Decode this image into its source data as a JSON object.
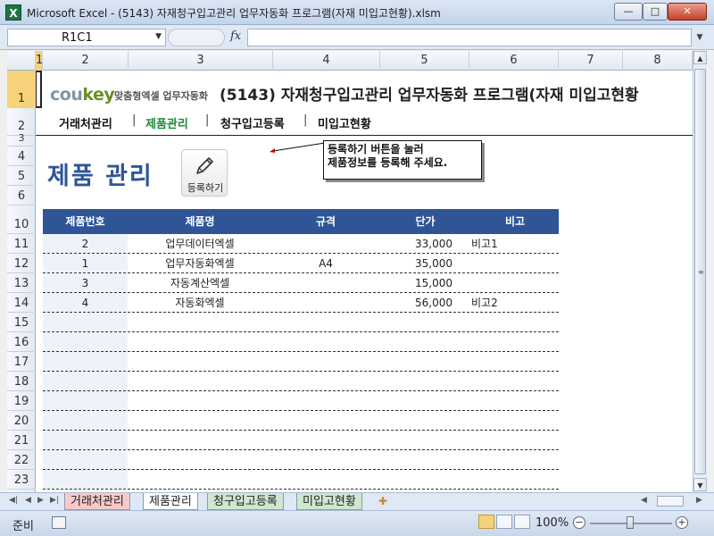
{
  "window": {
    "title": "Microsoft Excel - (5143) 자재청구입고관리 업무자동화 프로그램(자재 미입고현황).xlsm",
    "app_icon": "X",
    "minimize": "—",
    "maximize": "□",
    "close": "✕"
  },
  "formula_bar": {
    "name_box": "R1C1",
    "fx": "fx",
    "formula": ""
  },
  "columns": [
    "1",
    "2",
    "3",
    "4",
    "5",
    "6",
    "7",
    "8"
  ],
  "rows": [
    "1",
    "2",
    "3",
    "4",
    "5",
    "6",
    "10",
    "11",
    "12",
    "13",
    "14",
    "15",
    "16",
    "17",
    "18",
    "19",
    "20",
    "21",
    "22",
    "23"
  ],
  "header": {
    "logo_text_a": "cou",
    "logo_text_b": "key",
    "logo_sub": "맞춤형엑셀 업무자동화",
    "title": "(5143) 자재청구입고관리 업무자동화 프로그램(자재 미입고현황"
  },
  "nav": {
    "items": [
      "거래처관리",
      "제품관리",
      "청구입고등록",
      "미입고현황"
    ],
    "separator": "|",
    "active_index": 1,
    "active_color": "#1f8a3a"
  },
  "page": {
    "title": "제품 관리",
    "register_button": "등록하기",
    "callout_line1": "등록하기 버튼을 눌러",
    "callout_line2": "제품정보를 등록해 주세요."
  },
  "table": {
    "headers": [
      "제품번호",
      "제품명",
      "규격",
      "단가",
      "비고"
    ],
    "header_color": "#2f5597",
    "rows": [
      [
        "2",
        "업무데이터엑셀",
        "",
        "33,000",
        "비고1"
      ],
      [
        "1",
        "업무자동화엑셀",
        "A4",
        "35,000",
        ""
      ],
      [
        "3",
        "자동계산엑셀",
        "",
        "15,000",
        ""
      ],
      [
        "4",
        "자동화엑셀",
        "",
        "56,000",
        "비고2"
      ],
      [
        "",
        "",
        "",
        "",
        ""
      ],
      [
        "",
        "",
        "",
        "",
        ""
      ],
      [
        "",
        "",
        "",
        "",
        ""
      ],
      [
        "",
        "",
        "",
        "",
        ""
      ],
      [
        "",
        "",
        "",
        "",
        ""
      ],
      [
        "",
        "",
        "",
        "",
        ""
      ],
      [
        "",
        "",
        "",
        "",
        ""
      ],
      [
        "",
        "",
        "",
        "",
        ""
      ],
      [
        "",
        "",
        "",
        "",
        ""
      ]
    ]
  },
  "sheet_tabs": [
    "거래처관리",
    "제품관리",
    "청구입고등록",
    "미입고현황"
  ],
  "status": {
    "ready": "준비",
    "zoom": "100%",
    "zoom_minus": "−",
    "zoom_plus": "+"
  }
}
